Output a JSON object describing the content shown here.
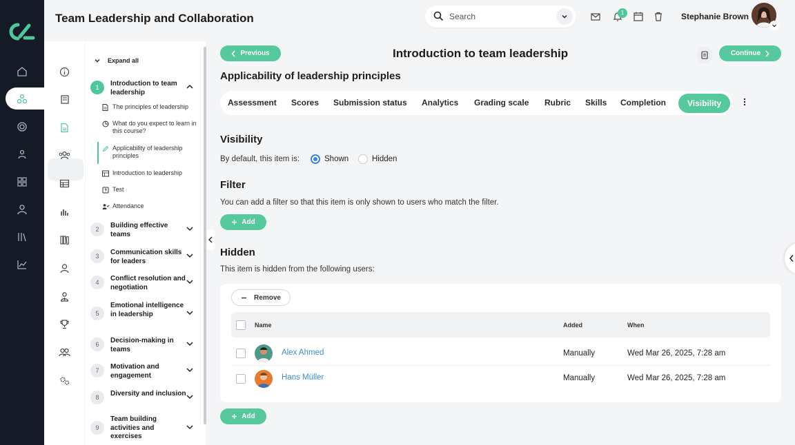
{
  "app": {
    "title": "Team Leadership and Collaboration"
  },
  "search": {
    "placeholder": "Search"
  },
  "notifications": {
    "count": "1"
  },
  "user": {
    "name": "Stephanie Brown"
  },
  "rail_icons": [
    "logo-icon",
    "home-icon",
    "network-icon",
    "target-icon",
    "users-icon",
    "grid-icon",
    "person-icon",
    "library-icon",
    "chart-icon"
  ],
  "side_icons": [
    "info-icon",
    "book-icon",
    "document-icon",
    "people-icon",
    "table-icon",
    "bar-chart-icon",
    "books-icon",
    "user-icon",
    "user-tie-icon",
    "trophy-icon",
    "group-icon",
    "settings-icon"
  ],
  "tree": {
    "expand_all": "Expand all",
    "modules": [
      {
        "num": "1",
        "title": "Introduction to team leadership",
        "expanded": true
      },
      {
        "num": "2",
        "title": "Building effective teams"
      },
      {
        "num": "3",
        "title": "Communication skills for leaders"
      },
      {
        "num": "4",
        "title": "Conflict resolution and negotiation"
      },
      {
        "num": "5",
        "title": "Emotional intelligence in leadership"
      },
      {
        "num": "6",
        "title": "Decision-making in teams"
      },
      {
        "num": "7",
        "title": "Motivation and engagement"
      },
      {
        "num": "8",
        "title": "Diversity and inclusion"
      },
      {
        "num": "9",
        "title": "Team building activities and exercises"
      }
    ],
    "lessons": [
      {
        "icon": "page-icon",
        "label": "The principles of leadership"
      },
      {
        "icon": "quiz-icon",
        "label": "What do you expect to learn in this course?"
      },
      {
        "icon": "pencil-icon",
        "label": "Applicability of leadership principles"
      },
      {
        "icon": "slides-icon",
        "label": "Introduction to leadership"
      },
      {
        "icon": "test-icon",
        "label": "Test"
      },
      {
        "icon": "attendance-icon",
        "label": "Attendance"
      }
    ]
  },
  "main": {
    "previous": "Previous",
    "continue": "Continue",
    "lesson_title": "Introduction to team leadership",
    "section_heading": "Applicability of leadership principles",
    "tabs": [
      "Assessment",
      "Scores",
      "Submission status",
      "Analytics",
      "Grading scale",
      "Rubric",
      "Skills",
      "Completion",
      "Visibility"
    ],
    "active_tab": "Visibility",
    "visibility": {
      "heading": "Visibility",
      "default_label": "By default, this item is:",
      "options": [
        "Shown",
        "Hidden"
      ],
      "selected": "Shown"
    },
    "filter": {
      "heading": "Filter",
      "description": "You can add a filter so that this item is only shown to users who match the filter.",
      "add": "Add"
    },
    "hidden": {
      "heading": "Hidden",
      "description": "This item is hidden from the following users:",
      "remove": "Remove",
      "columns": [
        "Name",
        "Added",
        "When"
      ],
      "rows": [
        {
          "name": "Alex Ahmed",
          "added": "Manually",
          "when": "Wed Mar 26, 2025, 7:28 am"
        },
        {
          "name": "Hans Müller",
          "added": "Manually",
          "when": "Wed Mar 26, 2025, 7:28 am"
        }
      ],
      "add": "Add"
    }
  },
  "colors": {
    "accent": "#55c89d",
    "rail": "#141a26",
    "link": "#3a8fd0",
    "radio": "#3b86d6"
  }
}
